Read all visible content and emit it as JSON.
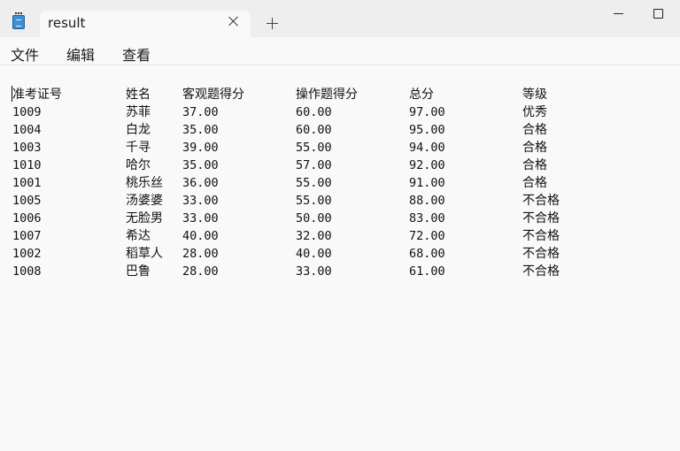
{
  "window": {
    "tab_title": "result",
    "icons": [
      "notepad-icon",
      "close-icon",
      "plus-icon",
      "minimize-icon",
      "maximize-icon"
    ]
  },
  "menu": [
    "文件",
    "编辑",
    "查看"
  ],
  "table": {
    "headers": [
      "准考证号",
      "姓名",
      "客观题得分",
      "操作题得分",
      "总分",
      "等级"
    ],
    "rows": [
      [
        "1009",
        "苏菲",
        "37.00",
        "60.00",
        "97.00",
        "优秀"
      ],
      [
        "1004",
        "白龙",
        "35.00",
        "60.00",
        "95.00",
        "合格"
      ],
      [
        "1003",
        "千寻",
        "39.00",
        "55.00",
        "94.00",
        "合格"
      ],
      [
        "1010",
        "哈尔",
        "35.00",
        "57.00",
        "92.00",
        "合格"
      ],
      [
        "1001",
        "桃乐丝",
        "36.00",
        "55.00",
        "91.00",
        "合格"
      ],
      [
        "1005",
        "汤婆婆",
        "33.00",
        "55.00",
        "88.00",
        "不合格"
      ],
      [
        "1006",
        "无脸男",
        "33.00",
        "50.00",
        "83.00",
        "不合格"
      ],
      [
        "1007",
        "希达",
        "40.00",
        "32.00",
        "72.00",
        "不合格"
      ],
      [
        "1002",
        "稻草人",
        "28.00",
        "40.00",
        "68.00",
        "不合格"
      ],
      [
        "1008",
        "巴鲁",
        "28.00",
        "33.00",
        "61.00",
        "不合格"
      ]
    ]
  }
}
